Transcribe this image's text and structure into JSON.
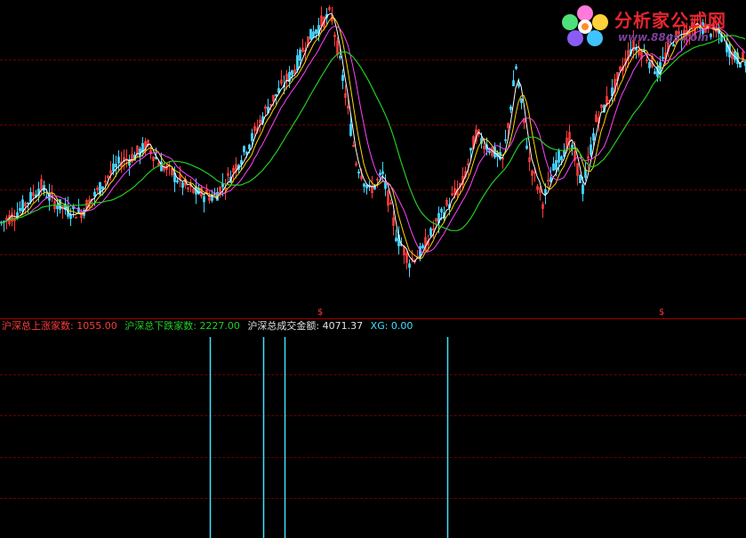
{
  "logo": {
    "name": "分析家公式网",
    "url": "www.88gs.com"
  },
  "legend": {
    "up_label": "沪深总上涨家数:",
    "up_value": "1055.00",
    "down_label": "沪深总下跌家数:",
    "down_value": "2227.00",
    "amount_label": "沪深总成交金额:",
    "amount_value": "4071.37",
    "xg_label": "XG:",
    "xg_value": "0.00"
  },
  "markers": {
    "symbol": "$"
  },
  "colors": {
    "background": "#000000",
    "grid": "#6a0000",
    "separator": "#a00000",
    "up_candle": "#ff3b3b",
    "down_candle": "#45d6ff",
    "ma_fast": "#ffffff",
    "ma_mid": "#ffd700",
    "ma_slow": "#ff44ff",
    "ma_long": "#22cc22",
    "signal": "#40e0ff"
  },
  "chart_data": [
    {
      "type": "candlestick",
      "title": "",
      "note": "price panel, no axis labels shown",
      "ylim": [
        0,
        100
      ],
      "price_path": [
        [
          0,
          22
        ],
        [
          15,
          25
        ],
        [
          30,
          30
        ],
        [
          45,
          36
        ],
        [
          60,
          30
        ],
        [
          75,
          27
        ],
        [
          90,
          26
        ],
        [
          105,
          32
        ],
        [
          120,
          39
        ],
        [
          135,
          45
        ],
        [
          150,
          47
        ],
        [
          165,
          51
        ],
        [
          180,
          44
        ],
        [
          195,
          40
        ],
        [
          210,
          35
        ],
        [
          225,
          33
        ],
        [
          240,
          32
        ],
        [
          255,
          38
        ],
        [
          270,
          46
        ],
        [
          285,
          55
        ],
        [
          300,
          65
        ],
        [
          315,
          72
        ],
        [
          330,
          79
        ],
        [
          345,
          90
        ],
        [
          360,
          96
        ],
        [
          372,
          100
        ],
        [
          385,
          76
        ],
        [
          400,
          45
        ],
        [
          415,
          34
        ],
        [
          430,
          40
        ],
        [
          445,
          18
        ],
        [
          460,
          8
        ],
        [
          475,
          12
        ],
        [
          490,
          22
        ],
        [
          505,
          30
        ],
        [
          520,
          37
        ],
        [
          535,
          55
        ],
        [
          550,
          50
        ],
        [
          565,
          45
        ],
        [
          580,
          80
        ],
        [
          595,
          45
        ],
        [
          610,
          30
        ],
        [
          625,
          45
        ],
        [
          640,
          53
        ],
        [
          655,
          35
        ],
        [
          670,
          60
        ],
        [
          690,
          72
        ],
        [
          710,
          88
        ],
        [
          725,
          85
        ],
        [
          740,
          78
        ],
        [
          755,
          90
        ],
        [
          770,
          93
        ],
        [
          790,
          95
        ],
        [
          810,
          92
        ],
        [
          825,
          84
        ],
        [
          839,
          82
        ]
      ],
      "ma_periods": [
        "ma_fast",
        "ma_mid",
        "ma_slow",
        "ma_long"
      ],
      "ma_windows": [
        3,
        6,
        11,
        26
      ],
      "signal_markers_x": [
        360,
        744
      ]
    },
    {
      "type": "bar",
      "title": "",
      "series": [
        {
          "name": "XG",
          "x": [
            236,
            296,
            320,
            503
          ],
          "values": [
            1,
            1,
            1,
            1
          ]
        }
      ],
      "ylim": [
        0,
        1
      ]
    }
  ]
}
